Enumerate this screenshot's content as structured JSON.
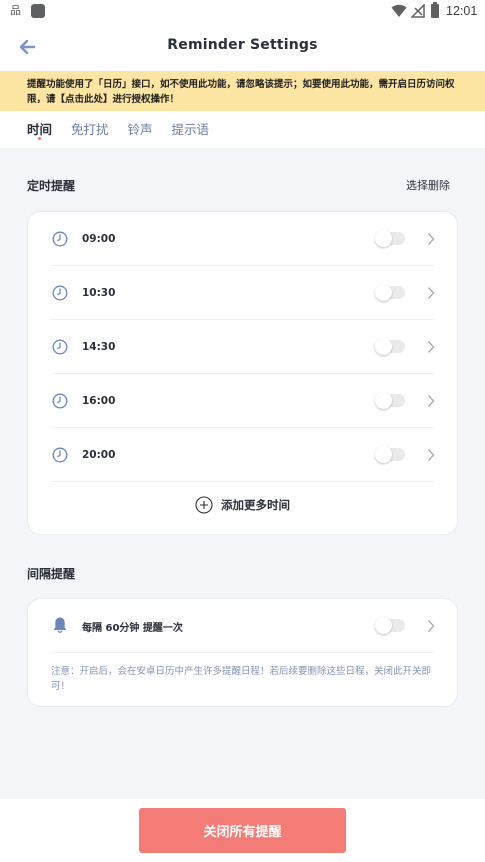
{
  "status_bar": {
    "left_icon_text": "品",
    "time": "12:01"
  },
  "header": {
    "title": "Reminder Settings"
  },
  "banner": {
    "text": "提醒功能使用了「日历」接口，如不使用此功能，请忽略该提示；如要使用此功能，需开启日历访问权限，请【点击此处】进行授权操作！"
  },
  "tabs": [
    {
      "label": "时间",
      "active": true
    },
    {
      "label": "免打扰",
      "active": false
    },
    {
      "label": "铃声",
      "active": false
    },
    {
      "label": "提示语",
      "active": false
    }
  ],
  "timed_section": {
    "title": "定时提醒",
    "action_label": "选择删除",
    "times": [
      {
        "label": "09:00",
        "enabled": false
      },
      {
        "label": "10:30",
        "enabled": false
      },
      {
        "label": "14:30",
        "enabled": false
      },
      {
        "label": "16:00",
        "enabled": false
      },
      {
        "label": "20:00",
        "enabled": false
      }
    ],
    "add_more_label": "添加更多时间"
  },
  "interval_section": {
    "title": "间隔提醒",
    "label": "每隔 60分钟 提醒一次",
    "enabled": false,
    "note": "注意：开启后，会在安卓日历中产生许多提醒日程！若后续要删除这些日程，关闭此开关即可！"
  },
  "bottom": {
    "close_all_label": "关闭所有提醒"
  },
  "colors": {
    "accent": "#f47c76",
    "banner_bg": "#fde6a4",
    "tab_inactive": "#6d7ea5",
    "icon_blue": "#6c86bd",
    "background": "#f4f5f9"
  },
  "icons": [
    "back-arrow-icon",
    "clock-icon",
    "chevron-right-icon",
    "plus-circle-icon",
    "bell-icon",
    "wifi-icon",
    "signal-icon",
    "battery-icon"
  ]
}
